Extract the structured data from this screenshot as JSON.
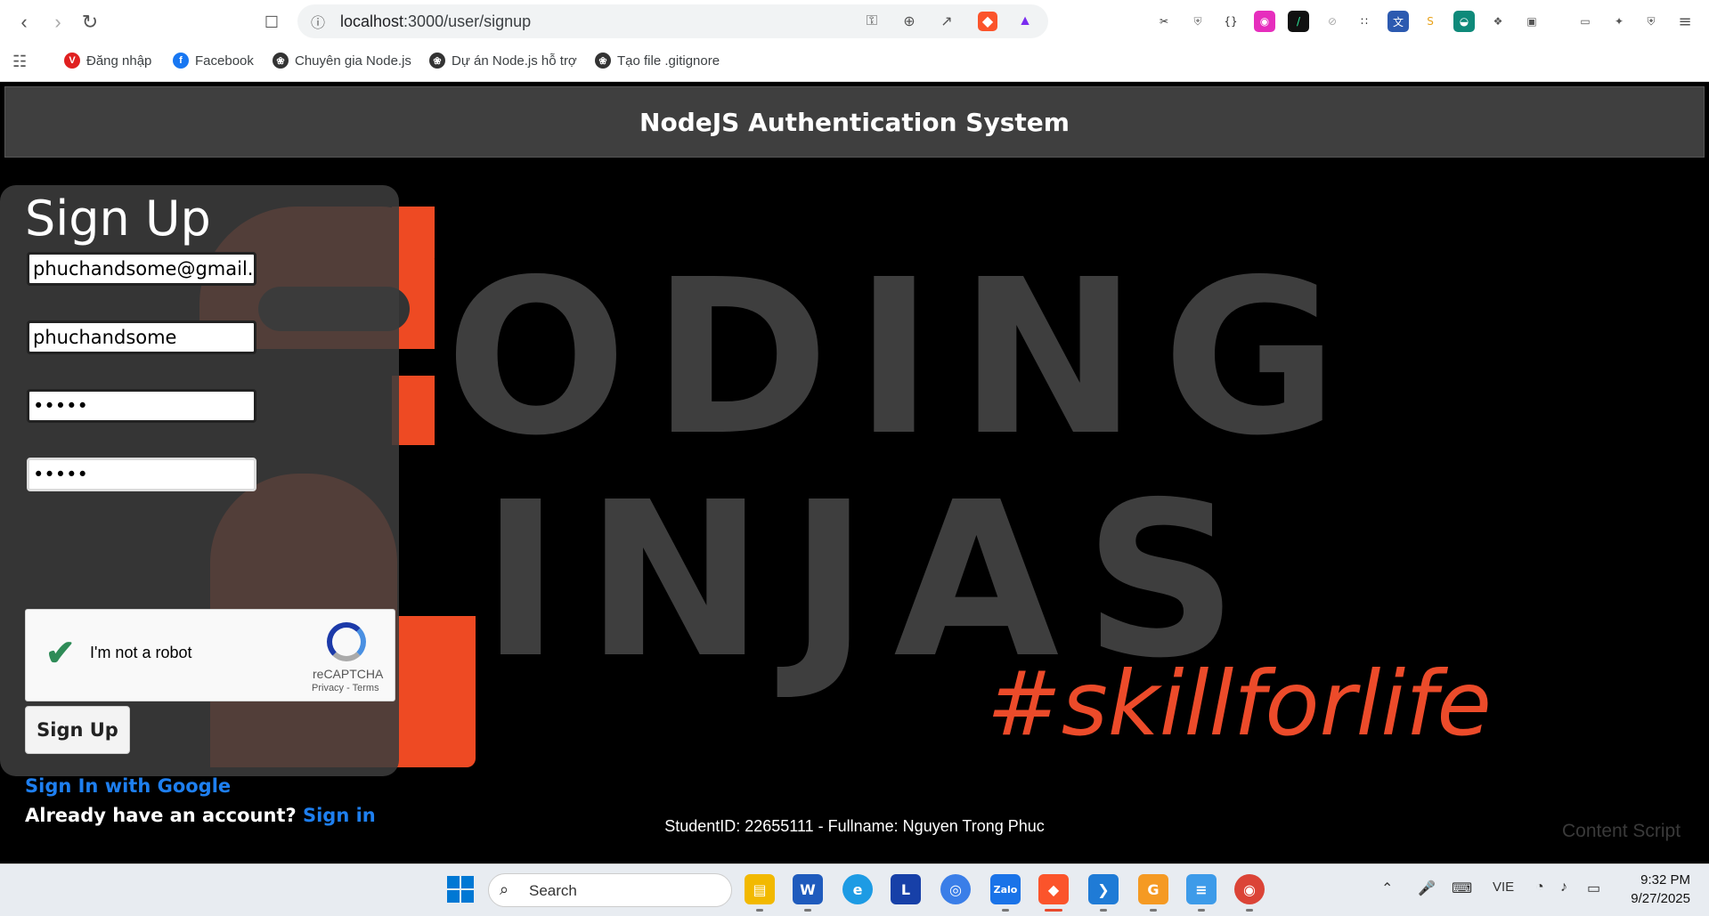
{
  "browser": {
    "url_host": "localhost",
    "url_rest": ":3000/user/signup",
    "bookmarks": [
      {
        "label": "Đăng nhập",
        "icon": "vh-logo-icon",
        "color": "#e02020"
      },
      {
        "label": "Facebook",
        "icon": "facebook-icon",
        "color": "#1877f2"
      },
      {
        "label": "Chuyên gia Node.js",
        "icon": "chatgpt-icon",
        "color": "#333333"
      },
      {
        "label": "Dự án Node.js hỗ trợ",
        "icon": "chatgpt-icon",
        "color": "#333333"
      },
      {
        "label": "Tạo file .gitignore",
        "icon": "chatgpt-icon",
        "color": "#333333"
      }
    ]
  },
  "header": {
    "title": "NodeJS Authentication System"
  },
  "background": {
    "line1": "ODING",
    "line2": "INJAS",
    "hashtag": "#skillforlife"
  },
  "signup": {
    "title": "Sign Up",
    "email_value": "phuchandsome@gmail.com",
    "username_value": "phuchandsome",
    "password_value": "•••••",
    "confirm_value": "•••••",
    "recaptcha_label": "I'm not a robot",
    "recaptcha_brand": "reCAPTCHA",
    "recaptcha_links": "Privacy - Terms",
    "submit_label": "Sign Up",
    "google_link": "Sign In with Google",
    "account_prompt": "Already have an account?",
    "signin_link": "Sign in"
  },
  "footer": {
    "text": "StudentID: 22655111 - Fullname: Nguyen Trong Phuc"
  },
  "overlay": {
    "content_script": "Content Script"
  },
  "taskbar": {
    "search_placeholder": "Search",
    "lang": "VIE",
    "time": "9:32 PM",
    "date": "9/27/2025"
  },
  "colors": {
    "accent_orange": "#ee4a23",
    "link_blue": "#1e7ff0"
  }
}
